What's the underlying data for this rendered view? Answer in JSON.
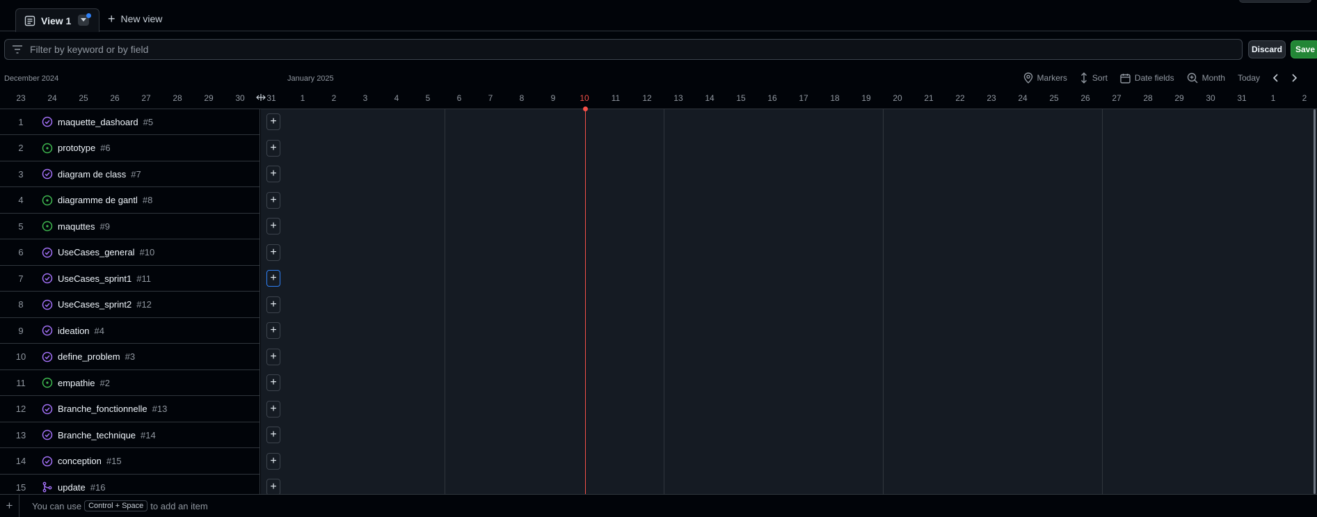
{
  "tabs": {
    "active_label": "View 1",
    "new_view_label": "New view"
  },
  "filter": {
    "placeholder": "Filter by keyword or by field",
    "discard_label": "Discard",
    "save_label": "Save"
  },
  "timeline": {
    "month_left": "December 2024",
    "month_right": "January 2025",
    "controls": {
      "markers": "Markers",
      "sort": "Sort",
      "date_fields": "Date fields",
      "zoom": "Month",
      "today": "Today"
    },
    "days": [
      "23",
      "24",
      "25",
      "26",
      "27",
      "28",
      "29",
      "30",
      "31",
      "1",
      "2",
      "3",
      "4",
      "5",
      "6",
      "7",
      "8",
      "9",
      "10",
      "11",
      "12",
      "13",
      "14",
      "15",
      "16",
      "17",
      "18",
      "19",
      "20",
      "21",
      "22",
      "23",
      "24",
      "25",
      "26",
      "27",
      "28",
      "29",
      "30",
      "31",
      "1",
      "2"
    ],
    "today_day": "10"
  },
  "items": [
    {
      "num": "1",
      "title": "maquette_dashoard",
      "issue": "#5",
      "status": "closed"
    },
    {
      "num": "2",
      "title": "prototype",
      "issue": "#6",
      "status": "open"
    },
    {
      "num": "3",
      "title": "diagram de class",
      "issue": "#7",
      "status": "closed"
    },
    {
      "num": "4",
      "title": "diagramme de gantl",
      "issue": "#8",
      "status": "open"
    },
    {
      "num": "5",
      "title": "maquttes",
      "issue": "#9",
      "status": "open"
    },
    {
      "num": "6",
      "title": "UseCases_general",
      "issue": "#10",
      "status": "closed"
    },
    {
      "num": "7",
      "title": "UseCases_sprint1",
      "issue": "#11",
      "status": "closed"
    },
    {
      "num": "8",
      "title": "UseCases_sprint2",
      "issue": "#12",
      "status": "closed"
    },
    {
      "num": "9",
      "title": "ideation",
      "issue": "#4",
      "status": "closed"
    },
    {
      "num": "10",
      "title": "define_problem",
      "issue": "#3",
      "status": "closed"
    },
    {
      "num": "11",
      "title": "empathie",
      "issue": "#2",
      "status": "open"
    },
    {
      "num": "12",
      "title": "Branche_fonctionnelle",
      "issue": "#13",
      "status": "closed"
    },
    {
      "num": "13",
      "title": "Branche_technique",
      "issue": "#14",
      "status": "closed"
    },
    {
      "num": "14",
      "title": "conception",
      "issue": "#15",
      "status": "closed"
    },
    {
      "num": "15",
      "title": "update",
      "issue": "#16",
      "status": "merged"
    }
  ],
  "footer": {
    "hint_prefix": "You can use",
    "shortcut": "Control + Space",
    "hint_suffix": "to add an item"
  },
  "colors": {
    "open": "#3fb950",
    "closed": "#a371f7",
    "today": "#f85149",
    "save": "#238636"
  }
}
